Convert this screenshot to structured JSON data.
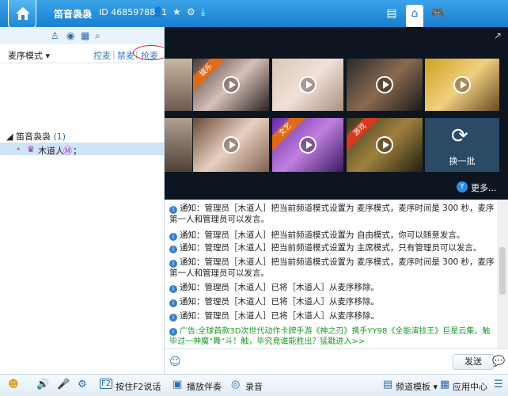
{
  "window": {
    "title": "笛音袅袅",
    "id_label": "ID 46859788",
    "online_count": "1",
    "icons": [
      "person-icon",
      "star-icon",
      "gear-icon",
      "download-icon",
      "news-icon",
      "channel-icon",
      "game-icon"
    ]
  },
  "left": {
    "mode_label": "麦序模式",
    "tabs": [
      "控麦",
      "禁麦",
      "抢麦"
    ],
    "tree_root": "笛音袅袅",
    "tree_root_count": "(1)",
    "user_name": "木道人",
    "user_suffix": "；"
  },
  "video": {
    "ribbons": [
      "娱乐",
      "文艺",
      "游戏"
    ],
    "refresh_label": "换一批",
    "more_label": "更多..."
  },
  "messages": [
    "通知：管理员［木道人］把当前频道模式设置为 麦序模式，麦序时间是 300 秒，麦序第一人和管理员可以发言。",
    "通知：管理员［木道人］把当前频道模式设置为 自由模式，你可以随意发言。",
    "通知：管理员［木道人］把当前频道模式设置为 主席模式，只有管理员可以发言。",
    "通知：管理员［木道人］把当前频道模式设置为 麦序模式，麦序时间是 300 秒，麦序第一人和管理员可以发言。",
    "通知：管理员［木道人］已将［木道人］从麦序移除。",
    "通知：管理员［木道人］已将［木道人］从麦序移除。",
    "通知：管理员［木道人］已将［木道人］从麦序移除。"
  ],
  "ad": "广告:全球首款3D次世代动作卡牌手游《神之刃》携手YY98《全能演技王》巨星云集，触毕过一神魔“舞”斗！触，毕究竟谁能胜出？猛戳进入>>",
  "input": {
    "send_label": "发送"
  },
  "bottom": {
    "f2_label": "按住F2说话",
    "accompany_label": "播放伴奏",
    "record_label": "录音",
    "template_label": "频道模板",
    "app_label": "应用中心"
  },
  "colors": {
    "titlebar": "#1a7fd0",
    "link": "#3a7fc4",
    "ad_text": "#1f9a2a",
    "highlight_circle": "#d32020"
  }
}
